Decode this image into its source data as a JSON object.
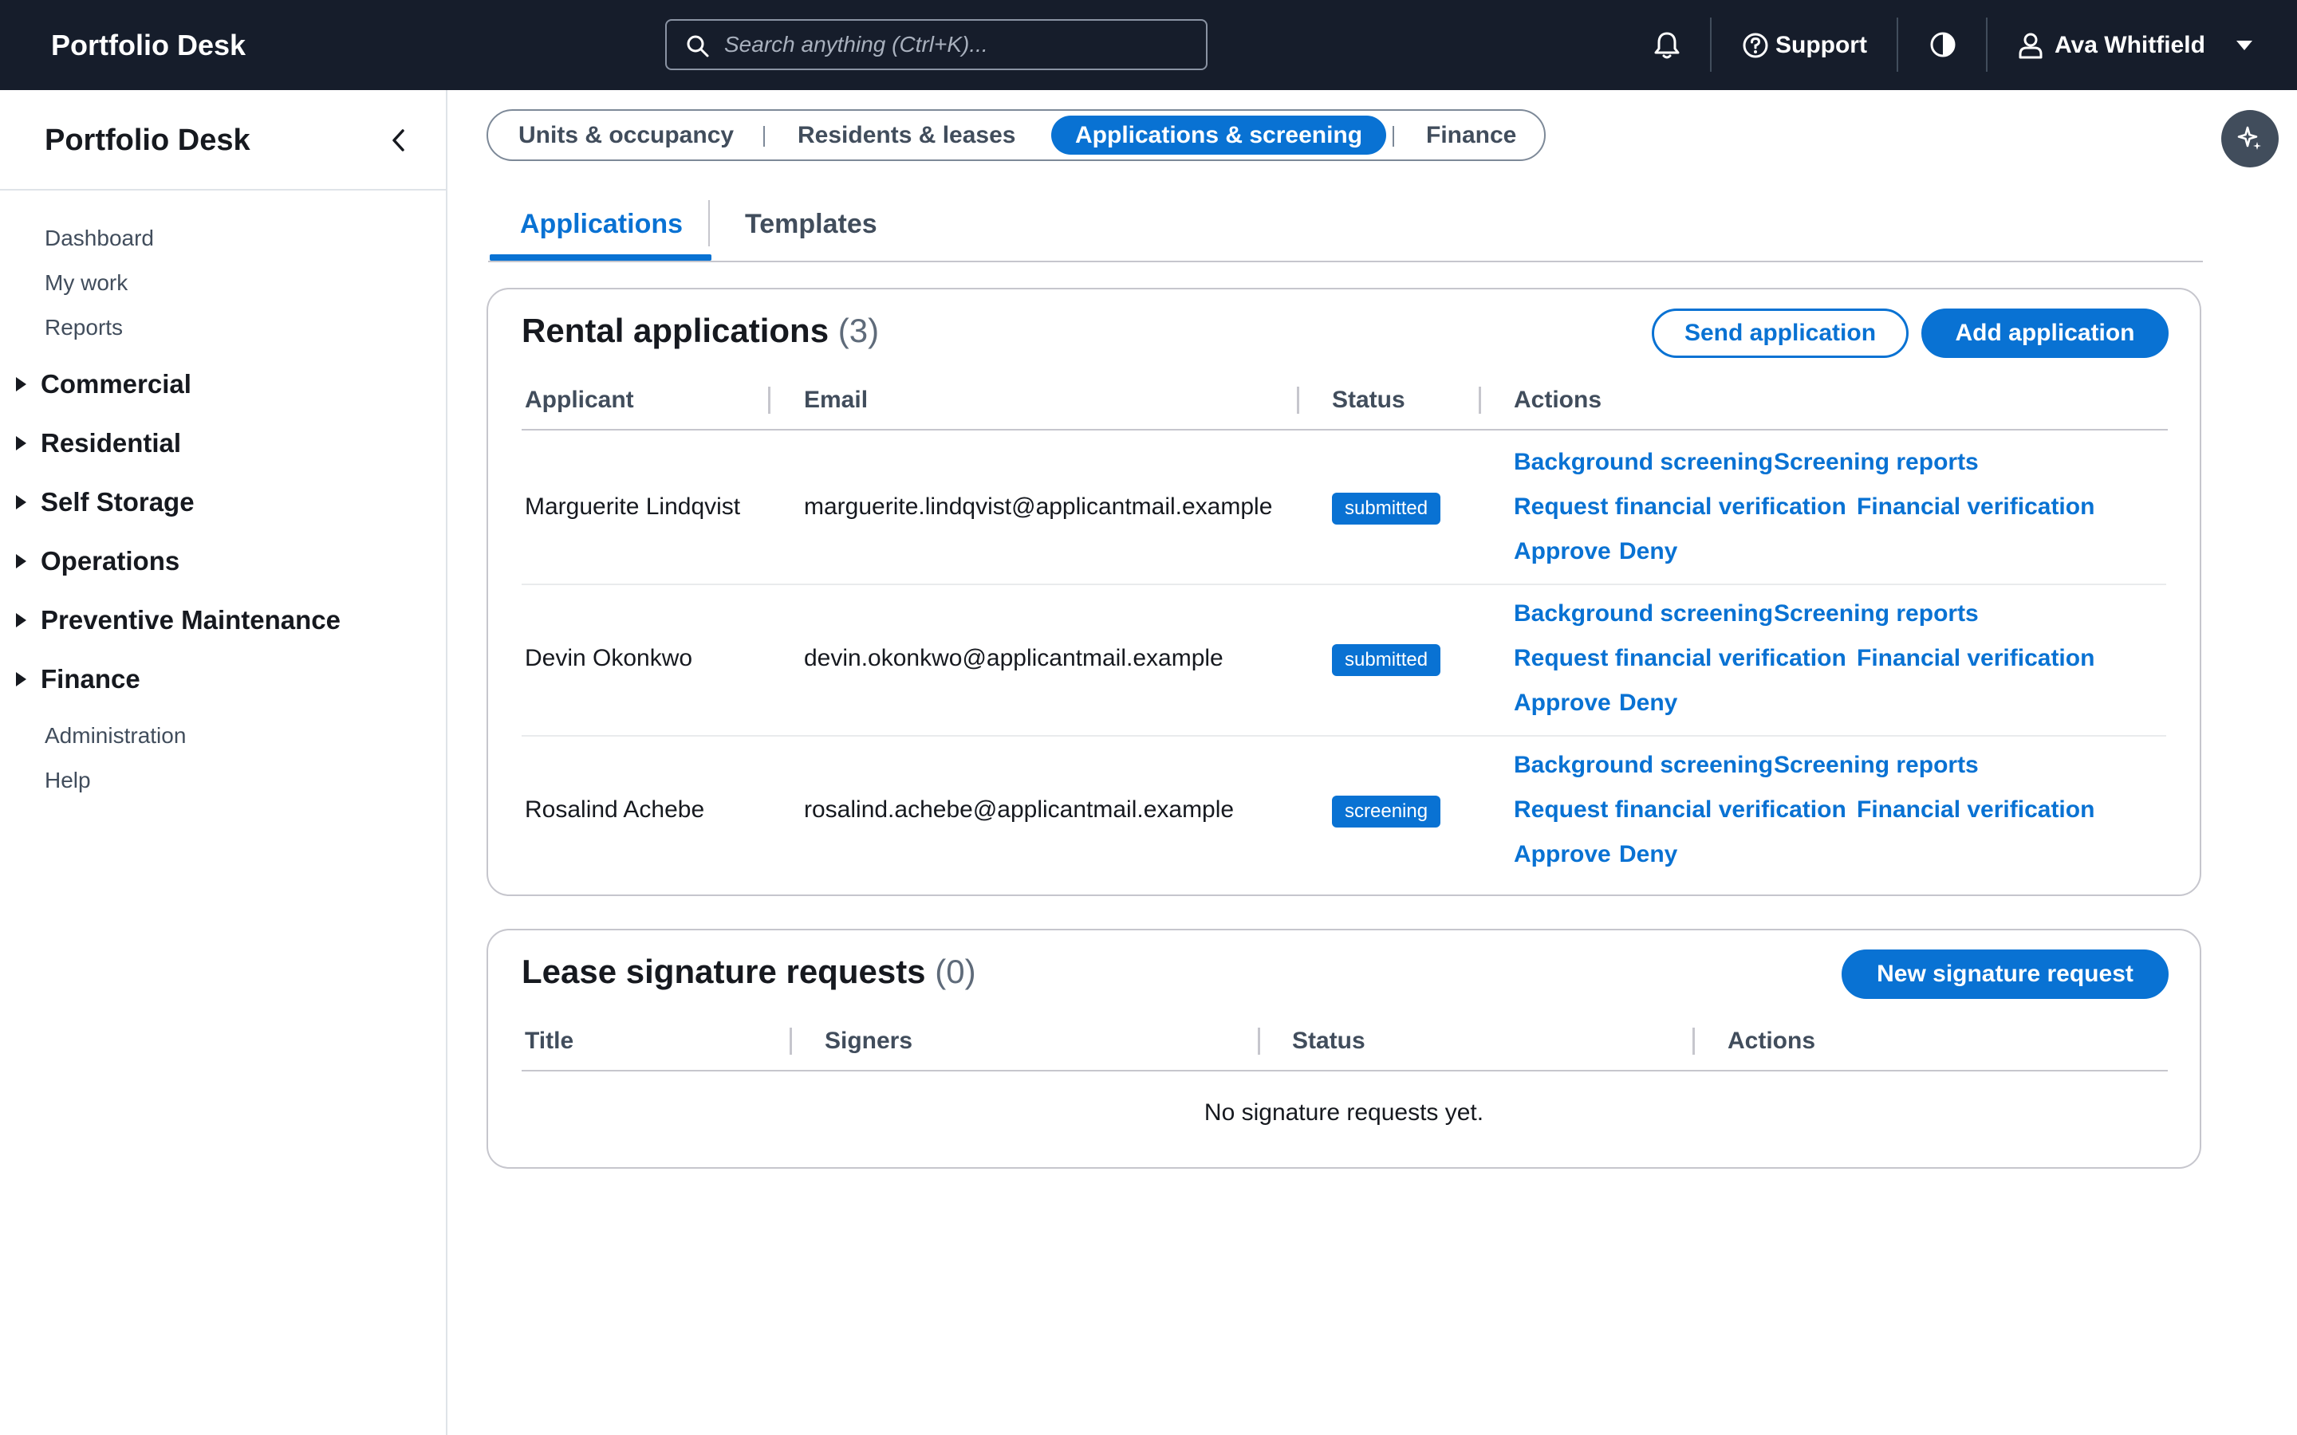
{
  "topbar": {
    "brand": "Portfolio Desk",
    "search_placeholder": "Search anything (Ctrl+K)...",
    "support_label": "Support",
    "user_name": "Ava Whitfield"
  },
  "sidebar": {
    "title": "Portfolio Desk",
    "links_top": [
      "Dashboard",
      "My work",
      "Reports"
    ],
    "groups": [
      "Commercial",
      "Residential",
      "Self Storage",
      "Operations",
      "Preventive Maintenance",
      "Finance"
    ],
    "links_bottom": [
      "Administration",
      "Help"
    ]
  },
  "segnav": [
    "Units & occupancy",
    "Residents & leases",
    "Applications & screening",
    "Finance"
  ],
  "tabs": [
    "Applications",
    "Templates"
  ],
  "applications": {
    "title": "Rental applications",
    "count": "(3)",
    "send_label": "Send application",
    "add_label": "Add application",
    "columns": [
      "Applicant",
      "Email",
      "Status",
      "Actions"
    ],
    "actions": {
      "background": "Background screening",
      "reports": "Screening reports",
      "request_fin": "Request financial verification",
      "fin": "Financial verification",
      "approve": "Approve",
      "deny": "Deny"
    },
    "rows": [
      {
        "name": "Marguerite Lindqvist",
        "email": "marguerite.lindqvist@applicantmail.example",
        "status": "submitted"
      },
      {
        "name": "Devin Okonkwo",
        "email": "devin.okonkwo@applicantmail.example",
        "status": "submitted"
      },
      {
        "name": "Rosalind Achebe",
        "email": "rosalind.achebe@applicantmail.example",
        "status": "screening"
      }
    ]
  },
  "signatures": {
    "title": "Lease signature requests",
    "count": "(0)",
    "new_label": "New signature request",
    "columns": [
      "Title",
      "Signers",
      "Status",
      "Actions"
    ],
    "empty": "No signature requests yet."
  }
}
